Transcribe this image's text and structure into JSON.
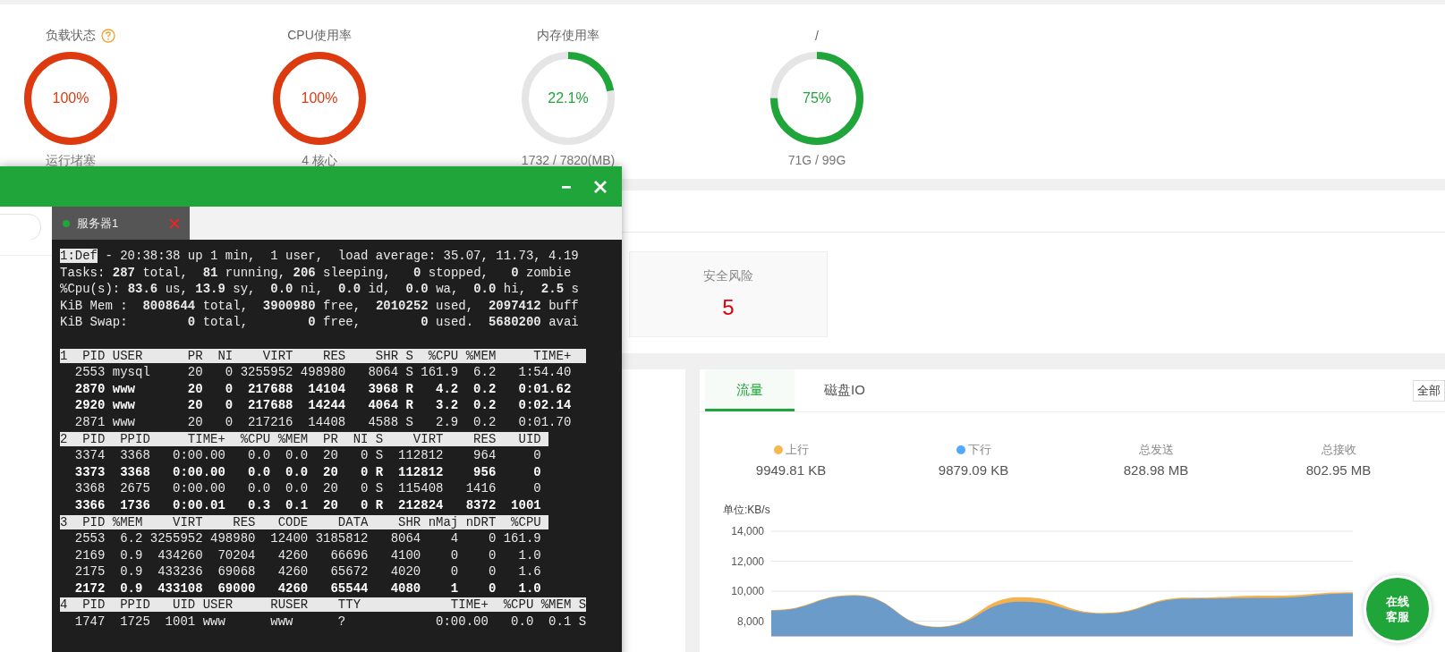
{
  "gauges": [
    {
      "label": "负载状态",
      "help": true,
      "value": "100%",
      "level": 1,
      "color": "#dd3a10",
      "caption": "运行堵塞"
    },
    {
      "label": "CPU使用率",
      "help": false,
      "value": "100%",
      "level": 1,
      "color": "#dd3a10",
      "caption": "4 核心"
    },
    {
      "label": "内存使用率",
      "help": false,
      "value": "22.1%",
      "level": 0.221,
      "color": "#20a53a",
      "caption": "1732 / 7820(MB)"
    },
    {
      "label": "/",
      "help": false,
      "value": "75%",
      "level": 0.75,
      "color": "#20a53a",
      "caption": "71G / 99G"
    }
  ],
  "security_card": {
    "label": "安全风险",
    "value": "5"
  },
  "traffic_panel": {
    "tabs": [
      {
        "label": "流量",
        "selected": true
      },
      {
        "label": "磁盘IO",
        "selected": false
      }
    ],
    "dropdown": "全部",
    "stats": [
      {
        "label": "上行",
        "color": "#f7b851",
        "value": "9949.81 KB"
      },
      {
        "label": "下行",
        "color": "#52a9ff",
        "value": "9879.09 KB"
      },
      {
        "label": "总发送",
        "value": "828.98 MB"
      },
      {
        "label": "总接收",
        "value": "802.95 MB"
      }
    ],
    "unit": "单位:KB/s",
    "chart_data": {
      "type": "area",
      "stacked": false,
      "grid": true,
      "ylim": [
        7000,
        14000
      ],
      "yticks": [
        {
          "value": 8000,
          "label": "8,000"
        },
        {
          "value": 10000,
          "label": "10,000"
        },
        {
          "value": 12000,
          "label": "12,000"
        },
        {
          "value": 14000,
          "label": "14,000"
        }
      ],
      "series": [
        {
          "color": "#f5b04f",
          "values": [
            8750,
            9750,
            7630,
            9600,
            8550,
            9560,
            9700,
            9930
          ]
        },
        {
          "color": "#6b9cc9",
          "values": [
            8700,
            9700,
            7600,
            9300,
            8500,
            9500,
            9550,
            9850
          ]
        }
      ]
    }
  },
  "chat_button": "在线客服",
  "terminal": {
    "tabs": [
      {
        "label": "服务器1",
        "selected": true
      }
    ],
    "lines": [
      {
        "kind": "status",
        "tag": "1:Def",
        "text": " - 20:38:38 up 1 min,  1 user,  load average: 35.07, 11.73, 4.19"
      },
      {
        "kind": "text",
        "text": "Tasks: **287** total,  **81** running, **206** sleeping,   **0** stopped,   **0** zombie"
      },
      {
        "kind": "text",
        "text": "%Cpu(s): **83.6** us, **13.9** sy,  **0.0** ni,  **0.0** id,  **0.0** wa,  **0.0** hi,  **2.5** s"
      },
      {
        "kind": "text",
        "text": "KiB Mem :  **8008644** total,  **3900980** free,  **2010252** used,  **2097412** buff"
      },
      {
        "kind": "text",
        "text": "KiB Swap:        **0** total,        **0** free,        **0** used.  **5680200** avai"
      },
      {
        "kind": "blank"
      },
      {
        "kind": "header",
        "text": "1  PID USER      PR  NI    VIRT    RES    SHR S  %CPU %MEM     TIME+  "
      },
      {
        "kind": "row",
        "bold": false,
        "text": "  2553 mysql     20   0 3255952 498980   8064 S 161.9  6.2   1:54.40"
      },
      {
        "kind": "row",
        "bold": true,
        "text": "  2870 www       20   0  217688  14104   3968 R   4.2  0.2   0:01.62"
      },
      {
        "kind": "row",
        "bold": true,
        "text": "  2920 www       20   0  217688  14244   4064 R   3.2  0.2   0:02.14"
      },
      {
        "kind": "row",
        "bold": false,
        "text": "  2871 www       20   0  217216  14408   4588 S   2.9  0.2   0:01.70"
      },
      {
        "kind": "header",
        "text": "2  PID  PPID     TIME+  %CPU %MEM  PR  NI S    VIRT    RES   UID "
      },
      {
        "kind": "row",
        "bold": false,
        "text": "  3374  3368   0:00.00   0.0  0.0  20   0 S  112812    964     0"
      },
      {
        "kind": "row",
        "bold": true,
        "text": "  3373  3368   0:00.00   0.0  0.0  20   0 R  112812    956     0"
      },
      {
        "kind": "row",
        "bold": false,
        "text": "  3368  2675   0:00.00   0.0  0.0  20   0 S  115408   1416     0"
      },
      {
        "kind": "row",
        "bold": true,
        "text": "  3366  1736   0:00.01   0.3  0.1  20   0 R  212824   8372  1001"
      },
      {
        "kind": "header",
        "text": "3  PID %MEM    VIRT    RES   CODE    DATA    SHR nMaj nDRT  %CPU "
      },
      {
        "kind": "row",
        "bold": false,
        "text": "  2553  6.2 3255952 498980  12400 3185812   8064    4    0 161.9"
      },
      {
        "kind": "row",
        "bold": false,
        "text": "  2169  0.9  434260  70204   4260   66696   4100    0    0   1.0"
      },
      {
        "kind": "row",
        "bold": false,
        "text": "  2175  0.9  433236  69068   4260   65672   4020    0    0   1.6"
      },
      {
        "kind": "row",
        "bold": true,
        "text": "  2172  0.9  433108  69000   4260   65544   4080    1    0   1.0"
      },
      {
        "kind": "header",
        "text": "4  PID  PPID   UID USER     RUSER    TTY            TIME+  %CPU %MEM S"
      },
      {
        "kind": "row",
        "bold": false,
        "text": "  1747  1725  1001 www      www      ?            0:00.00   0.0  0.1 S"
      }
    ]
  }
}
